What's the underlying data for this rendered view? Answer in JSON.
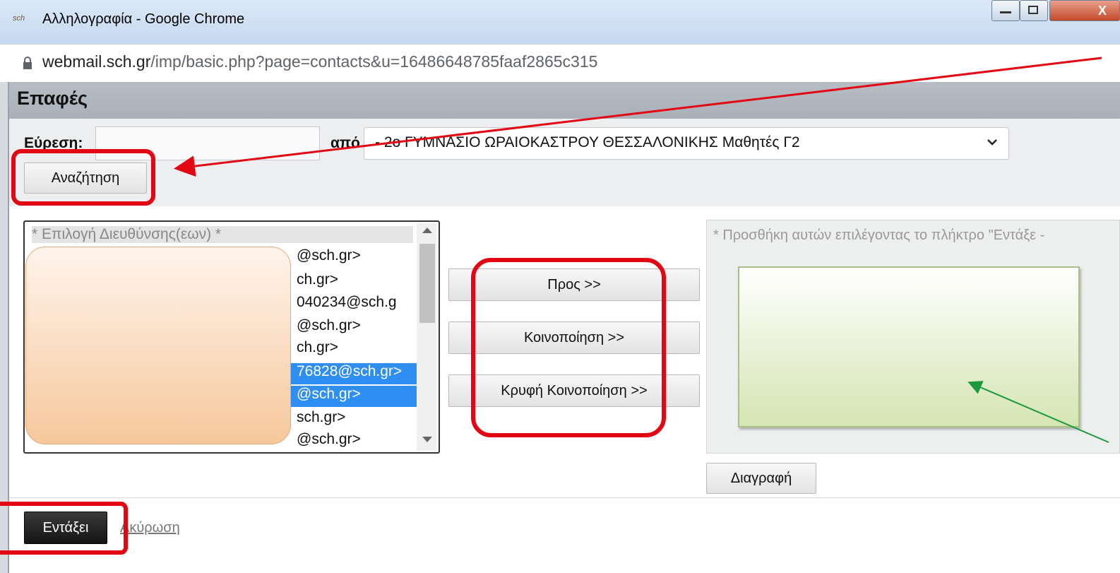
{
  "window": {
    "app_icon": "sch",
    "title": "Αλληλογραφία - Google Chrome",
    "close_glyph": "X"
  },
  "browser": {
    "url_host": "webmail.sch.gr",
    "url_path": "/imp/basic.php?page=contacts&u=16486648785faaf2865c315"
  },
  "page": {
    "title": "Επαφές"
  },
  "search": {
    "label": "Εύρεση:",
    "value": "",
    "from_label": "από",
    "source": "- 2ο ΓΥΜΝΑΣΙΟ ΩΡΑΙΟΚΑΣΤΡΟΥ ΘΕΣΣΑΛΟΝΙΚΗΣ Μαθητές Γ2",
    "button": "Αναζήτηση"
  },
  "address_list": {
    "header": "* Επιλογή Διευθύνσης(εων) *",
    "items": [
      {
        "text": "@sch.gr>",
        "selected": false
      },
      {
        "text": "ch.gr>",
        "selected": false
      },
      {
        "text": "040234@sch.g",
        "selected": false
      },
      {
        "text": "@sch.gr>",
        "selected": false
      },
      {
        "text": "ch.gr>",
        "selected": false
      },
      {
        "text": "76828@sch.gr>",
        "selected": true
      },
      {
        "text": "@sch.gr>",
        "selected": true
      },
      {
        "text": "sch.gr>",
        "selected": false
      },
      {
        "text": "@sch.gr>",
        "selected": false
      }
    ]
  },
  "actions": {
    "to": "Προς >>",
    "cc": "Κοινοποίηση >>",
    "bcc": "Κρυφή Κοινοποίηση >>"
  },
  "selected_panel": {
    "hint": "* Προσθήκη αυτών επιλέγοντας το πλήκτρο \"Εντάξε -",
    "delete_button": "Διαγραφή"
  },
  "footer": {
    "ok": "Εντάξει",
    "cancel": "Ακύρωση"
  },
  "colors": {
    "highlight": "#e30613",
    "arrow_red": "#e30613",
    "arrow_green": "#1a9a3c",
    "selection": "#2f8ef2"
  }
}
